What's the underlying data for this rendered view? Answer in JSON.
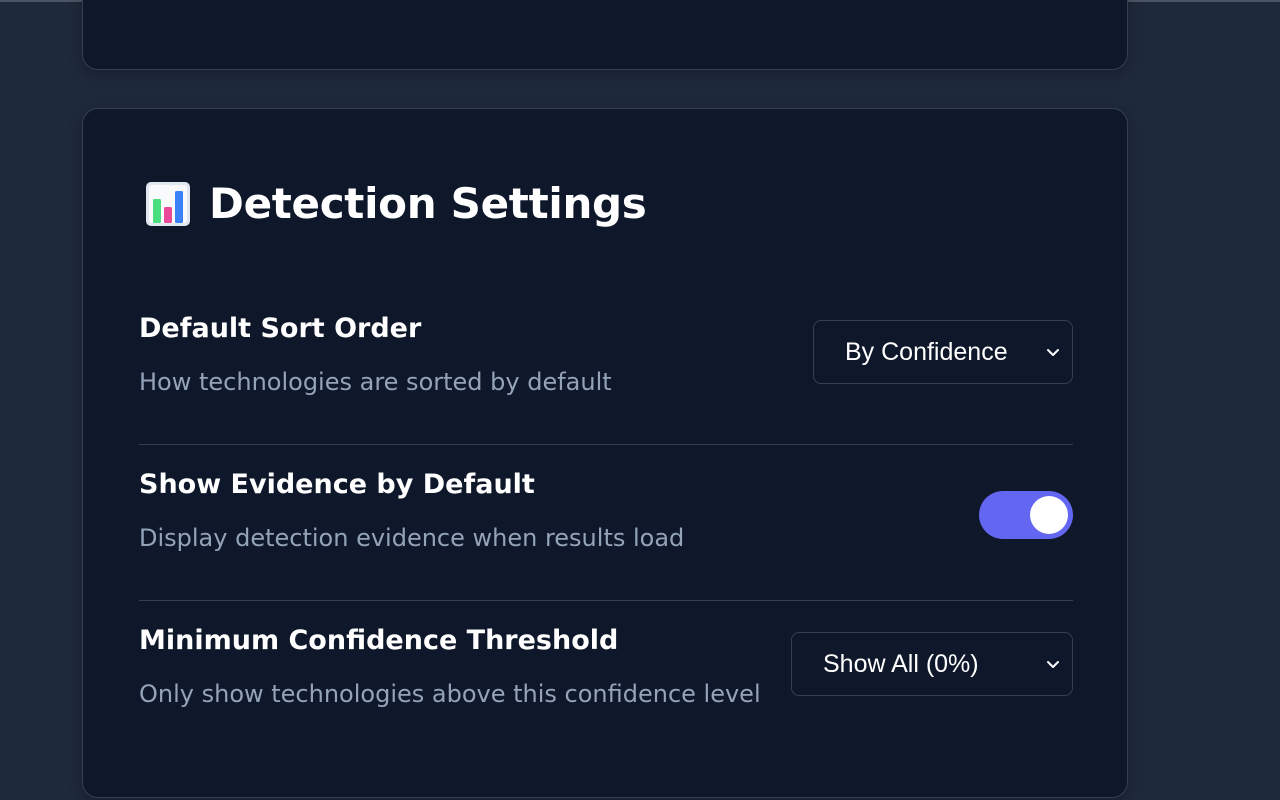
{
  "section": {
    "icon": "bar-chart-icon",
    "title": "Detection Settings"
  },
  "settings": [
    {
      "label": "Default Sort Order",
      "description": "How technologies are sorted by default",
      "control": "select",
      "value": "By Confidence"
    },
    {
      "label": "Show Evidence by Default",
      "description": "Display detection evidence when results load",
      "control": "toggle",
      "value": true
    },
    {
      "label": "Minimum Confidence Threshold",
      "description": "Only show technologies above this confidence level",
      "control": "select",
      "value": "Show All (0%)"
    }
  ],
  "colors": {
    "page_bg": "#1e293b",
    "card_bg": "#0f172a",
    "card_border": "#334155",
    "toggle_on": "#6366f1",
    "label": "#ffffff",
    "description": "#94a3b8"
  }
}
